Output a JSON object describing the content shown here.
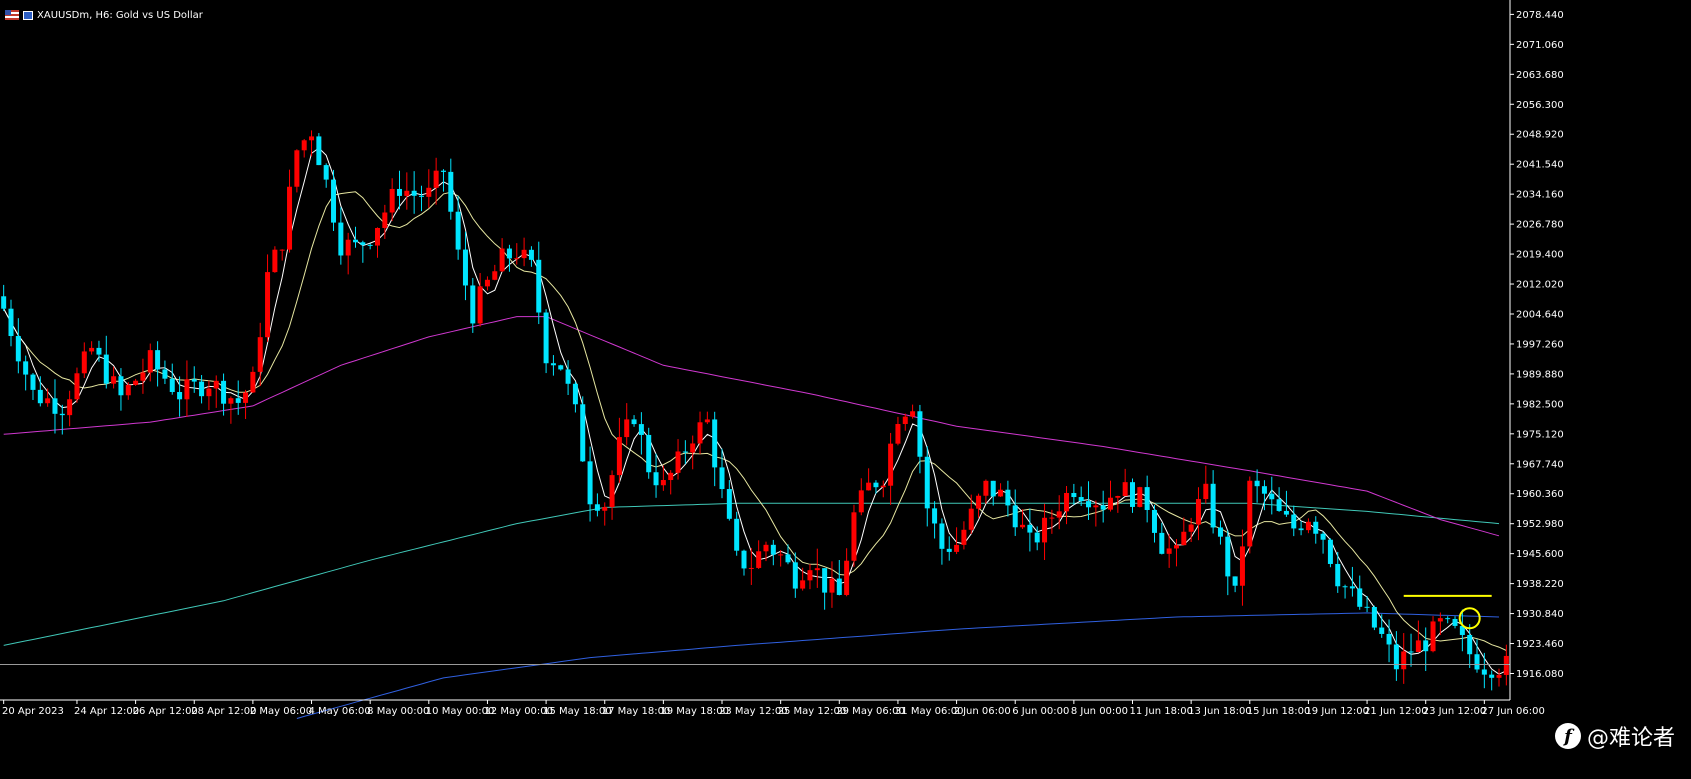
{
  "header": {
    "title": "XAUUSDm, H6:  Gold vs US Dollar",
    "icons": [
      "flag-icon",
      "chart-type-icon"
    ]
  },
  "watermark": {
    "text": "@难论者",
    "logo": "f"
  },
  "colors": {
    "background": "#000000",
    "bull": "#ff0000",
    "bear": "#00e5ff",
    "ma_white": "#ffffff",
    "ma_yellow": "#e6e6a0",
    "ma_magenta": "#d038d0",
    "ma_teal": "#40c8b8",
    "ma_blue": "#3060e0",
    "level": "#ffff00",
    "axis": "#ffffff"
  },
  "chart_data": {
    "type": "candlestick",
    "symbol": "XAUUSDm",
    "timeframe": "H6",
    "ylim": [
      1913.0,
      2081.0
    ],
    "yticks": [
      "2078.440",
      "2071.060",
      "2063.680",
      "2056.300",
      "2048.920",
      "2041.540",
      "2034.160",
      "2026.780",
      "2019.400",
      "2012.020",
      "2004.640",
      "1997.260",
      "1989.880",
      "1982.500",
      "1975.120",
      "1967.740",
      "1960.360",
      "1952.980",
      "1945.600",
      "1938.220",
      "1930.840",
      "1923.460",
      "1916.080"
    ],
    "xticks": [
      {
        "label": "20 Apr 2023",
        "bar": 0
      },
      {
        "label": "24 Apr 12:00",
        "bar": 10
      },
      {
        "label": "26 Apr 12:00",
        "bar": 18
      },
      {
        "label": "28 Apr 12:00",
        "bar": 26
      },
      {
        "label": "2 May 06:00",
        "bar": 34
      },
      {
        "label": "4 May 06:00",
        "bar": 42
      },
      {
        "label": "8 May 00:00",
        "bar": 50
      },
      {
        "label": "10 May 00:00",
        "bar": 58
      },
      {
        "label": "12 May 00:00",
        "bar": 66
      },
      {
        "label": "15 May 18:00",
        "bar": 74
      },
      {
        "label": "17 May 18:00",
        "bar": 82
      },
      {
        "label": "19 May 18:00",
        "bar": 90
      },
      {
        "label": "23 May 12:00",
        "bar": 98
      },
      {
        "label": "25 May 12:00",
        "bar": 106
      },
      {
        "label": "29 May 06:00",
        "bar": 114
      },
      {
        "label": "31 May 06:00",
        "bar": 122
      },
      {
        "label": "2 Jun 06:00",
        "bar": 130
      },
      {
        "label": "6 Jun 00:00",
        "bar": 138
      },
      {
        "label": "8 Jun 00:00",
        "bar": 146
      },
      {
        "label": "11 Jun 18:00",
        "bar": 154
      },
      {
        "label": "13 Jun 18:00",
        "bar": 162
      },
      {
        "label": "15 Jun 18:00",
        "bar": 170
      },
      {
        "label": "19 Jun 12:00",
        "bar": 178
      },
      {
        "label": "21 Jun 12:00",
        "bar": 186
      },
      {
        "label": "23 Jun 12:00",
        "bar": 194
      },
      {
        "label": "27 Jun 06:00",
        "bar": 202
      }
    ],
    "current_price": 1918.3,
    "resistance_level": 1935.2,
    "circle_marker": {
      "bar": 200,
      "price": 1929.7
    },
    "candles_close_path": [
      [
        0,
        2006
      ],
      [
        4,
        1985
      ],
      [
        8,
        1982
      ],
      [
        12,
        1996
      ],
      [
        16,
        1984
      ],
      [
        20,
        1993
      ],
      [
        24,
        1985
      ],
      [
        28,
        1988
      ],
      [
        32,
        1983
      ],
      [
        34,
        1988
      ],
      [
        36,
        2014
      ],
      [
        38,
        2023
      ],
      [
        40,
        2045
      ],
      [
        42,
        2050
      ],
      [
        44,
        2037
      ],
      [
        46,
        2022
      ],
      [
        48,
        2021
      ],
      [
        50,
        2024
      ],
      [
        52,
        2030
      ],
      [
        54,
        2036
      ],
      [
        56,
        2034
      ],
      [
        58,
        2034
      ],
      [
        60,
        2040
      ],
      [
        62,
        2019
      ],
      [
        64,
        2005
      ],
      [
        66,
        2012
      ],
      [
        68,
        2018
      ],
      [
        70,
        2020
      ],
      [
        72,
        2016
      ],
      [
        74,
        1995
      ],
      [
        76,
        1992
      ],
      [
        78,
        1980
      ],
      [
        80,
        1960
      ],
      [
        82,
        1958
      ],
      [
        84,
        1972
      ],
      [
        86,
        1980
      ],
      [
        88,
        1967
      ],
      [
        90,
        1962
      ],
      [
        92,
        1968
      ],
      [
        94,
        1975
      ],
      [
        96,
        1978
      ],
      [
        98,
        1960
      ],
      [
        100,
        1944
      ],
      [
        102,
        1943
      ],
      [
        104,
        1948
      ],
      [
        106,
        1945
      ],
      [
        108,
        1940
      ],
      [
        110,
        1944
      ],
      [
        112,
        1938
      ],
      [
        114,
        1935
      ],
      [
        116,
        1955
      ],
      [
        118,
        1962
      ],
      [
        120,
        1965
      ],
      [
        122,
        1980
      ],
      [
        124,
        1983
      ],
      [
        126,
        1957
      ],
      [
        128,
        1947
      ],
      [
        130,
        1948
      ],
      [
        132,
        1955
      ],
      [
        134,
        1962
      ],
      [
        136,
        1960
      ],
      [
        138,
        1955
      ],
      [
        140,
        1948
      ],
      [
        142,
        1952
      ],
      [
        144,
        1958
      ],
      [
        146,
        1962
      ],
      [
        148,
        1960
      ],
      [
        150,
        1958
      ],
      [
        152,
        1962
      ],
      [
        154,
        1960
      ],
      [
        156,
        1958
      ],
      [
        158,
        1948
      ],
      [
        160,
        1945
      ],
      [
        162,
        1955
      ],
      [
        164,
        1960
      ],
      [
        166,
        1948
      ],
      [
        168,
        1935
      ],
      [
        170,
        1962
      ],
      [
        172,
        1960
      ],
      [
        174,
        1955
      ],
      [
        176,
        1952
      ],
      [
        178,
        1955
      ],
      [
        180,
        1950
      ],
      [
        182,
        1940
      ],
      [
        184,
        1935
      ],
      [
        186,
        1930
      ],
      [
        188,
        1925
      ],
      [
        190,
        1918
      ],
      [
        192,
        1922
      ],
      [
        194,
        1924
      ],
      [
        196,
        1928
      ],
      [
        198,
        1926
      ],
      [
        200,
        1921
      ],
      [
        202,
        1918
      ]
    ],
    "series": [
      {
        "name": "",
        "color_key": "ma_white"
      },
      {
        "name": "",
        "color_key": "ma_yellow"
      },
      {
        "name": "",
        "color_key": "ma_magenta"
      },
      {
        "name": "",
        "color_key": "ma_teal"
      },
      {
        "name": "",
        "color_key": "ma_blue"
      }
    ],
    "ma_magenta_path": [
      [
        0,
        1975
      ],
      [
        20,
        1978
      ],
      [
        34,
        1982
      ],
      [
        46,
        1992
      ],
      [
        58,
        1999
      ],
      [
        70,
        2004
      ],
      [
        74,
        2004
      ],
      [
        90,
        1992
      ],
      [
        110,
        1985
      ],
      [
        130,
        1977
      ],
      [
        150,
        1972
      ],
      [
        170,
        1966
      ],
      [
        186,
        1961
      ],
      [
        196,
        1954
      ],
      [
        204,
        1950
      ]
    ],
    "ma_teal_path": [
      [
        0,
        1923
      ],
      [
        30,
        1934
      ],
      [
        50,
        1944
      ],
      [
        70,
        1953
      ],
      [
        82,
        1957
      ],
      [
        100,
        1958
      ],
      [
        130,
        1958
      ],
      [
        150,
        1958
      ],
      [
        170,
        1958
      ],
      [
        186,
        1956
      ],
      [
        204,
        1953
      ]
    ],
    "ma_blue_path": [
      [
        40,
        1905
      ],
      [
        60,
        1915
      ],
      [
        80,
        1920
      ],
      [
        100,
        1923
      ],
      [
        130,
        1927
      ],
      [
        160,
        1930
      ],
      [
        186,
        1931
      ],
      [
        204,
        1930
      ]
    ]
  }
}
